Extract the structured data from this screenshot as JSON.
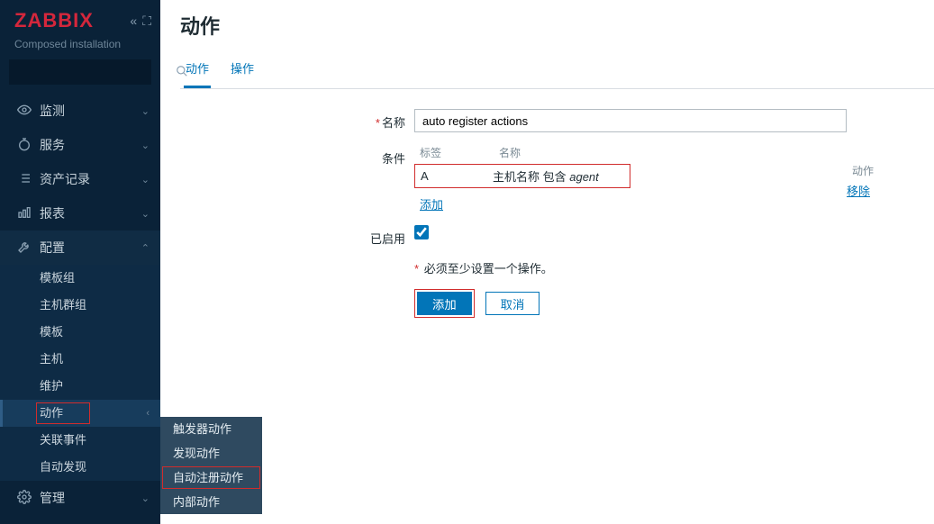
{
  "brand": "ZABBIX",
  "subtitle": "Composed installation",
  "nav": {
    "monitor": "监测",
    "services": "服务",
    "inventory": "资产记录",
    "reports": "报表",
    "config": "配置",
    "admin": "管理"
  },
  "config_sub": {
    "tpl_groups": "模板组",
    "host_groups": "主机群组",
    "templates": "模板",
    "hosts": "主机",
    "maintenance": "维护",
    "actions": "动作",
    "correlation": "关联事件",
    "discovery": "自动发现"
  },
  "flyout": {
    "trigger": "触发器动作",
    "discovery": "发现动作",
    "autoreg": "自动注册动作",
    "internal": "内部动作"
  },
  "page": {
    "title": "动作",
    "tab_action": "动作",
    "tab_operation": "操作",
    "label_name": "名称",
    "label_cond": "条件",
    "label_enabled": "已启用",
    "col_tag": "标签",
    "col_name": "名称",
    "col_act": "动作",
    "cond_tag": "A",
    "cond_name_prefix": "主机名称 包含 ",
    "cond_name_italic": "agent",
    "remove": "移除",
    "add_link": "添加",
    "must_msg": "必须至少设置一个操作。",
    "btn_add": "添加",
    "btn_cancel": "取消",
    "name_value": "auto register actions"
  }
}
